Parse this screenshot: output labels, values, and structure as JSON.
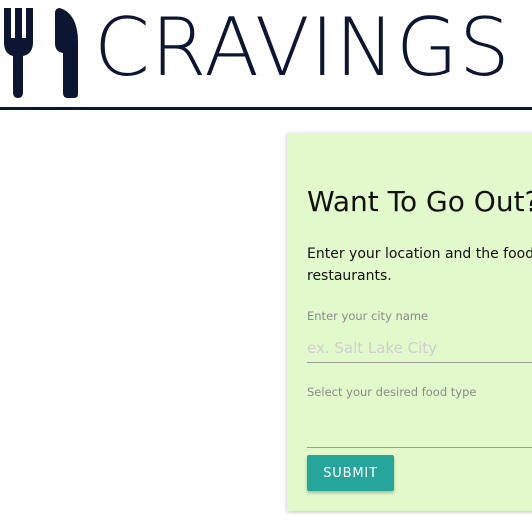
{
  "header": {
    "brand_name": "CRAVINGS",
    "logo_icon": "fork-knife-icon",
    "brand_color": "#0c1633"
  },
  "card": {
    "background_color": "#e1f9cb",
    "title": "Want To Go Out?",
    "description": "Enter your location and the food type to find restaurants.",
    "city_field": {
      "label": "Enter your city name",
      "placeholder": "ex. Salt Lake City",
      "value": ""
    },
    "food_field": {
      "label": "Select your desired food type",
      "value": ""
    },
    "submit_label": "SUBMIT",
    "submit_color": "#26a69a"
  }
}
